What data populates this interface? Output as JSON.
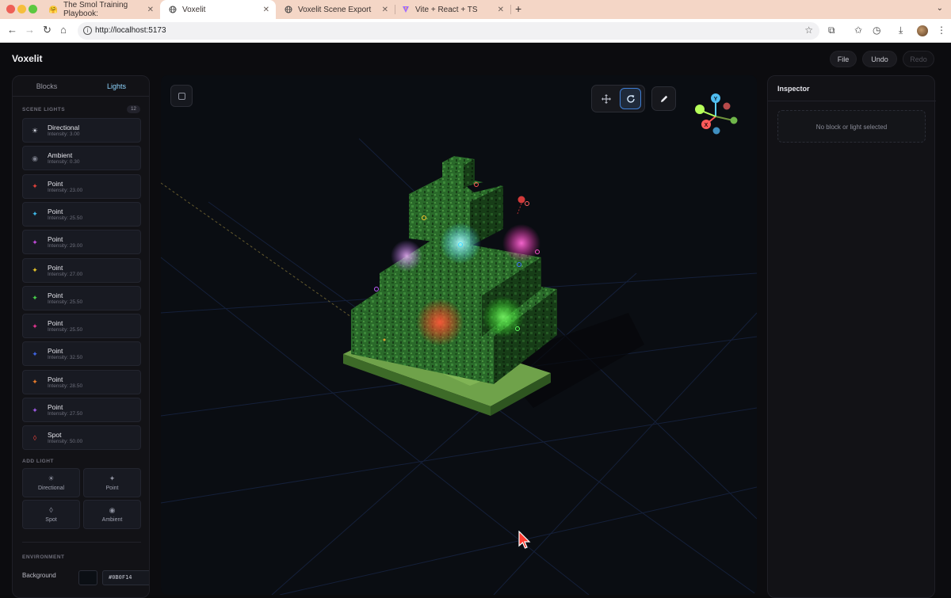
{
  "browser": {
    "tabs": [
      {
        "title": "The Smol Training Playbook:",
        "icon": "hugging-face-icon"
      },
      {
        "title": "Voxelit",
        "icon": "globe-icon",
        "active": true
      },
      {
        "title": "Voxelit Scene Export",
        "icon": "globe-icon"
      },
      {
        "title": "Vite + React + TS",
        "icon": "vite-icon"
      }
    ],
    "url": "http://localhost:5173"
  },
  "app": {
    "title": "Voxelit",
    "header_buttons": {
      "file": "File",
      "undo": "Undo",
      "redo": "Redo"
    }
  },
  "left_panel": {
    "tabs": {
      "blocks": "Blocks",
      "lights": "Lights"
    },
    "scene_lights_label": "SCENE LIGHTS",
    "scene_lights_count": "12",
    "lights": [
      {
        "name": "Directional",
        "intensity": "Intensity: 3.00",
        "color": "#d8dbe6",
        "icon": "sun-icon"
      },
      {
        "name": "Ambient",
        "intensity": "Intensity: 0.30",
        "color": "#7c7f8c",
        "icon": "ambient-icon"
      },
      {
        "name": "Point",
        "intensity": "Intensity: 23.00",
        "color": "#e0413a",
        "icon": "point-light-icon"
      },
      {
        "name": "Point",
        "intensity": "Intensity: 25.50",
        "color": "#3fb8e8",
        "icon": "point-light-icon"
      },
      {
        "name": "Point",
        "intensity": "Intensity: 29.00",
        "color": "#c04ad8",
        "icon": "point-light-icon"
      },
      {
        "name": "Point",
        "intensity": "Intensity: 27.00",
        "color": "#e3c22a",
        "icon": "point-light-icon"
      },
      {
        "name": "Point",
        "intensity": "Intensity: 25.50",
        "color": "#48d04b",
        "icon": "point-light-icon"
      },
      {
        "name": "Point",
        "intensity": "Intensity: 25.50",
        "color": "#e0358f",
        "icon": "point-light-icon"
      },
      {
        "name": "Point",
        "intensity": "Intensity: 32.50",
        "color": "#3f64e0",
        "icon": "point-light-icon"
      },
      {
        "name": "Point",
        "intensity": "Intensity: 28.50",
        "color": "#e57a2b",
        "icon": "point-light-icon"
      },
      {
        "name": "Point",
        "intensity": "Intensity: 27.50",
        "color": "#9b5ae0",
        "icon": "point-light-icon"
      },
      {
        "name": "Spot",
        "intensity": "Intensity: 50.00",
        "color": "#e0413a",
        "icon": "spot-light-icon"
      }
    ],
    "add_light_label": "ADD LIGHT",
    "add_buttons": {
      "directional": "Directional",
      "point": "Point",
      "spot": "Spot",
      "ambient": "Ambient"
    },
    "environment_label": "ENVIRONMENT",
    "background_label": "Background",
    "background_value": "#0B0F14"
  },
  "viewport": {
    "gizmo_axes": {
      "y": "Y",
      "x": "X"
    },
    "active_tool": "rotate"
  },
  "inspector": {
    "title": "Inspector",
    "empty_text": "No block or light selected"
  }
}
